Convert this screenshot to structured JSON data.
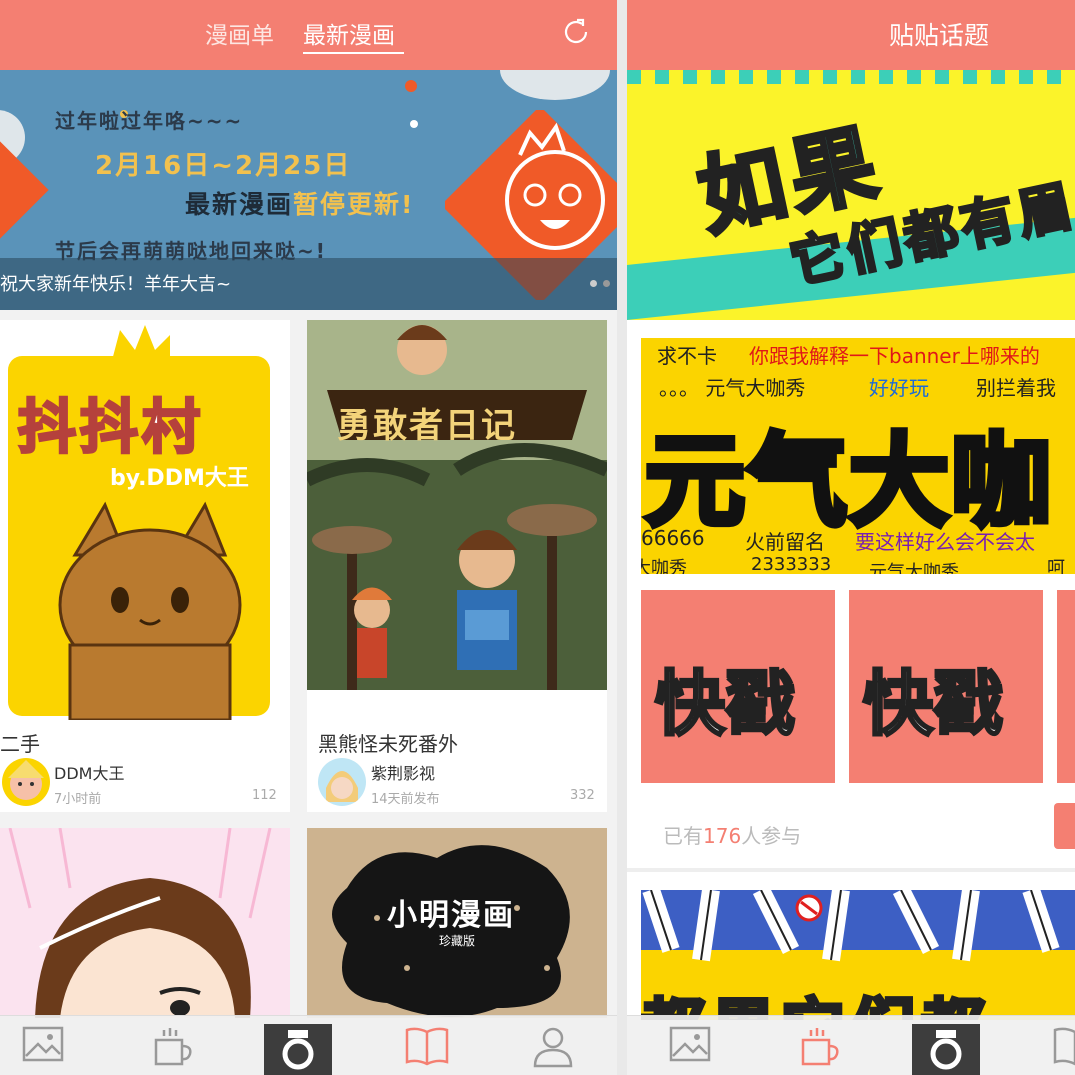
{
  "left_screen": {
    "tabs": [
      {
        "label": "漫画单",
        "active": false
      },
      {
        "label": "最新漫画",
        "active": true
      }
    ],
    "refresh_icon": "refresh-icon",
    "banner": {
      "line1": "过年啦过年咯~~~",
      "line2": "2月16日~2月25日",
      "line3a": "最新漫画",
      "line3b": "暂停更新!",
      "line4": "节后会再萌萌哒地回来哒~!",
      "caption": "祝大家新年快乐！羊年大吉~"
    },
    "cards": [
      {
        "cover_text": "抖抖村",
        "cover_sub": "by.DDM大王",
        "title": "二手",
        "author": "DDM大王",
        "time": "7小时前",
        "count": "112"
      },
      {
        "cover_text": "勇敢者日记",
        "title": "黑熊怪未死番外",
        "author": "紫荆影视",
        "time": "14天前发布",
        "count": "332"
      },
      {
        "cover_text": ""
      },
      {
        "cover_text": "小明漫画",
        "cover_sub": "珍藏版"
      }
    ],
    "nav": [
      {
        "icon": "image-icon",
        "active": false
      },
      {
        "icon": "cup-icon",
        "active": false
      },
      {
        "icon": "camera-icon",
        "active": false
      },
      {
        "icon": "book-icon",
        "active": true
      },
      {
        "icon": "user-icon",
        "active": false
      }
    ]
  },
  "right_screen": {
    "title": "贴贴话题",
    "banner1": {
      "line1": "如果",
      "line2": "它们都有眉"
    },
    "banner2": {
      "row1a": "求不卡",
      "row1b": "你跟我解释一下banner上哪来的",
      "row2a": "。。。 元气大咖秀",
      "row2b": "好好玩",
      "row2c": "别拦着我",
      "big": "元气大咖",
      "row3a": "66666",
      "row3b": "火前留名",
      "row3c": "要这样好么会不会太",
      "row4a": "大咖秀",
      "row4b": "2333333",
      "row4c": "元气大咖秀",
      "row4d": "呵"
    },
    "tiles": [
      "快戳",
      "快戳"
    ],
    "participants_prefix": "已有",
    "participants_count": "176",
    "participants_suffix": "人参与",
    "banner3_text": "都果它们都"
  },
  "colors": {
    "accent": "#f47f72",
    "banner_blue": "#5a93b9",
    "yellow": "#fbd400"
  }
}
